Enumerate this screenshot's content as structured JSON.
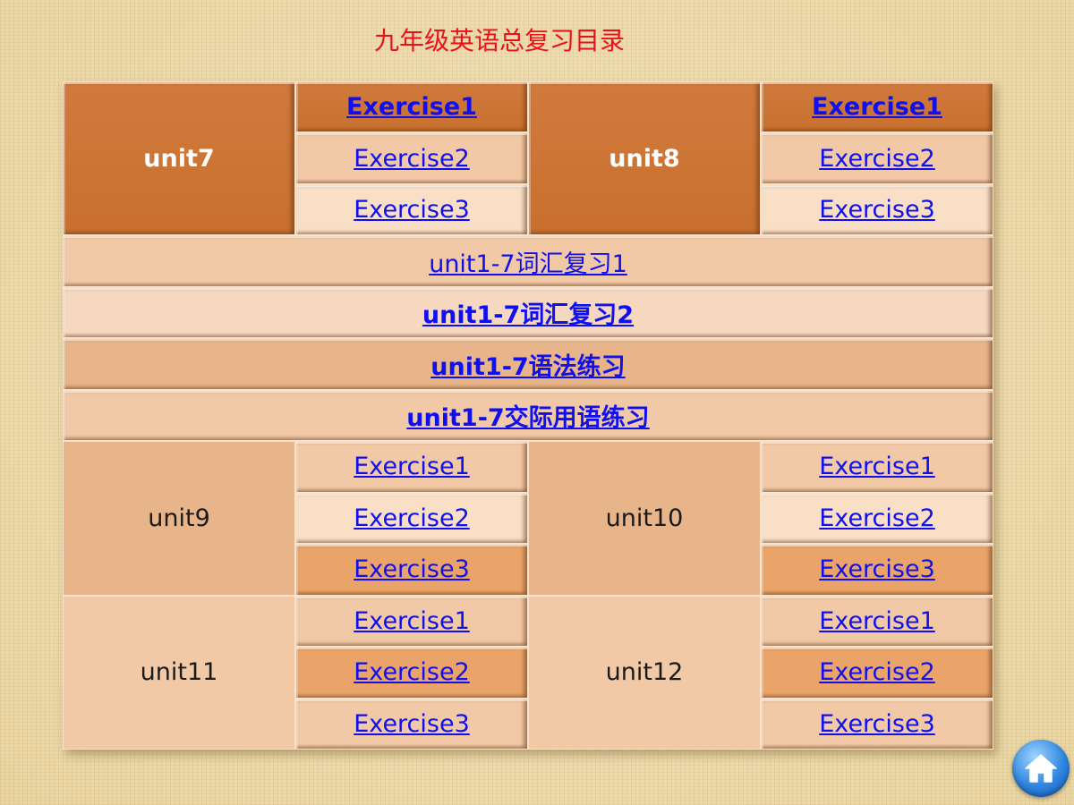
{
  "title": "九年级英语总复习目录",
  "blocks": [
    {
      "unit_left": "unit7",
      "unit_right": "unit8",
      "left_exercises": [
        "Exercise1",
        "Exercise2",
        "Exercise3"
      ],
      "right_exercises": [
        "Exercise1",
        "Exercise2",
        "Exercise3"
      ]
    },
    {
      "unit_left": "unit9",
      "unit_right": "unit10",
      "left_exercises": [
        "Exercise1",
        "Exercise2",
        "Exercise3"
      ],
      "right_exercises": [
        "Exercise1",
        "Exercise2",
        "Exercise3"
      ]
    },
    {
      "unit_left": "unit11",
      "unit_right": "unit12",
      "left_exercises": [
        "Exercise1",
        "Exercise2",
        "Exercise3"
      ],
      "right_exercises": [
        "Exercise1",
        "Exercise2",
        "Exercise3"
      ]
    }
  ],
  "review_links": [
    "unit1-7词汇复习1",
    "unit1-7词汇复习2",
    "unit1-7语法练习",
    "unit1-7交际用语练习"
  ],
  "colors": {
    "title": "#e8121b",
    "link": "#1010ee",
    "dark_cell": "#c9702f",
    "home_button": "#2f86e0"
  },
  "icons": {
    "home": "home-icon"
  }
}
